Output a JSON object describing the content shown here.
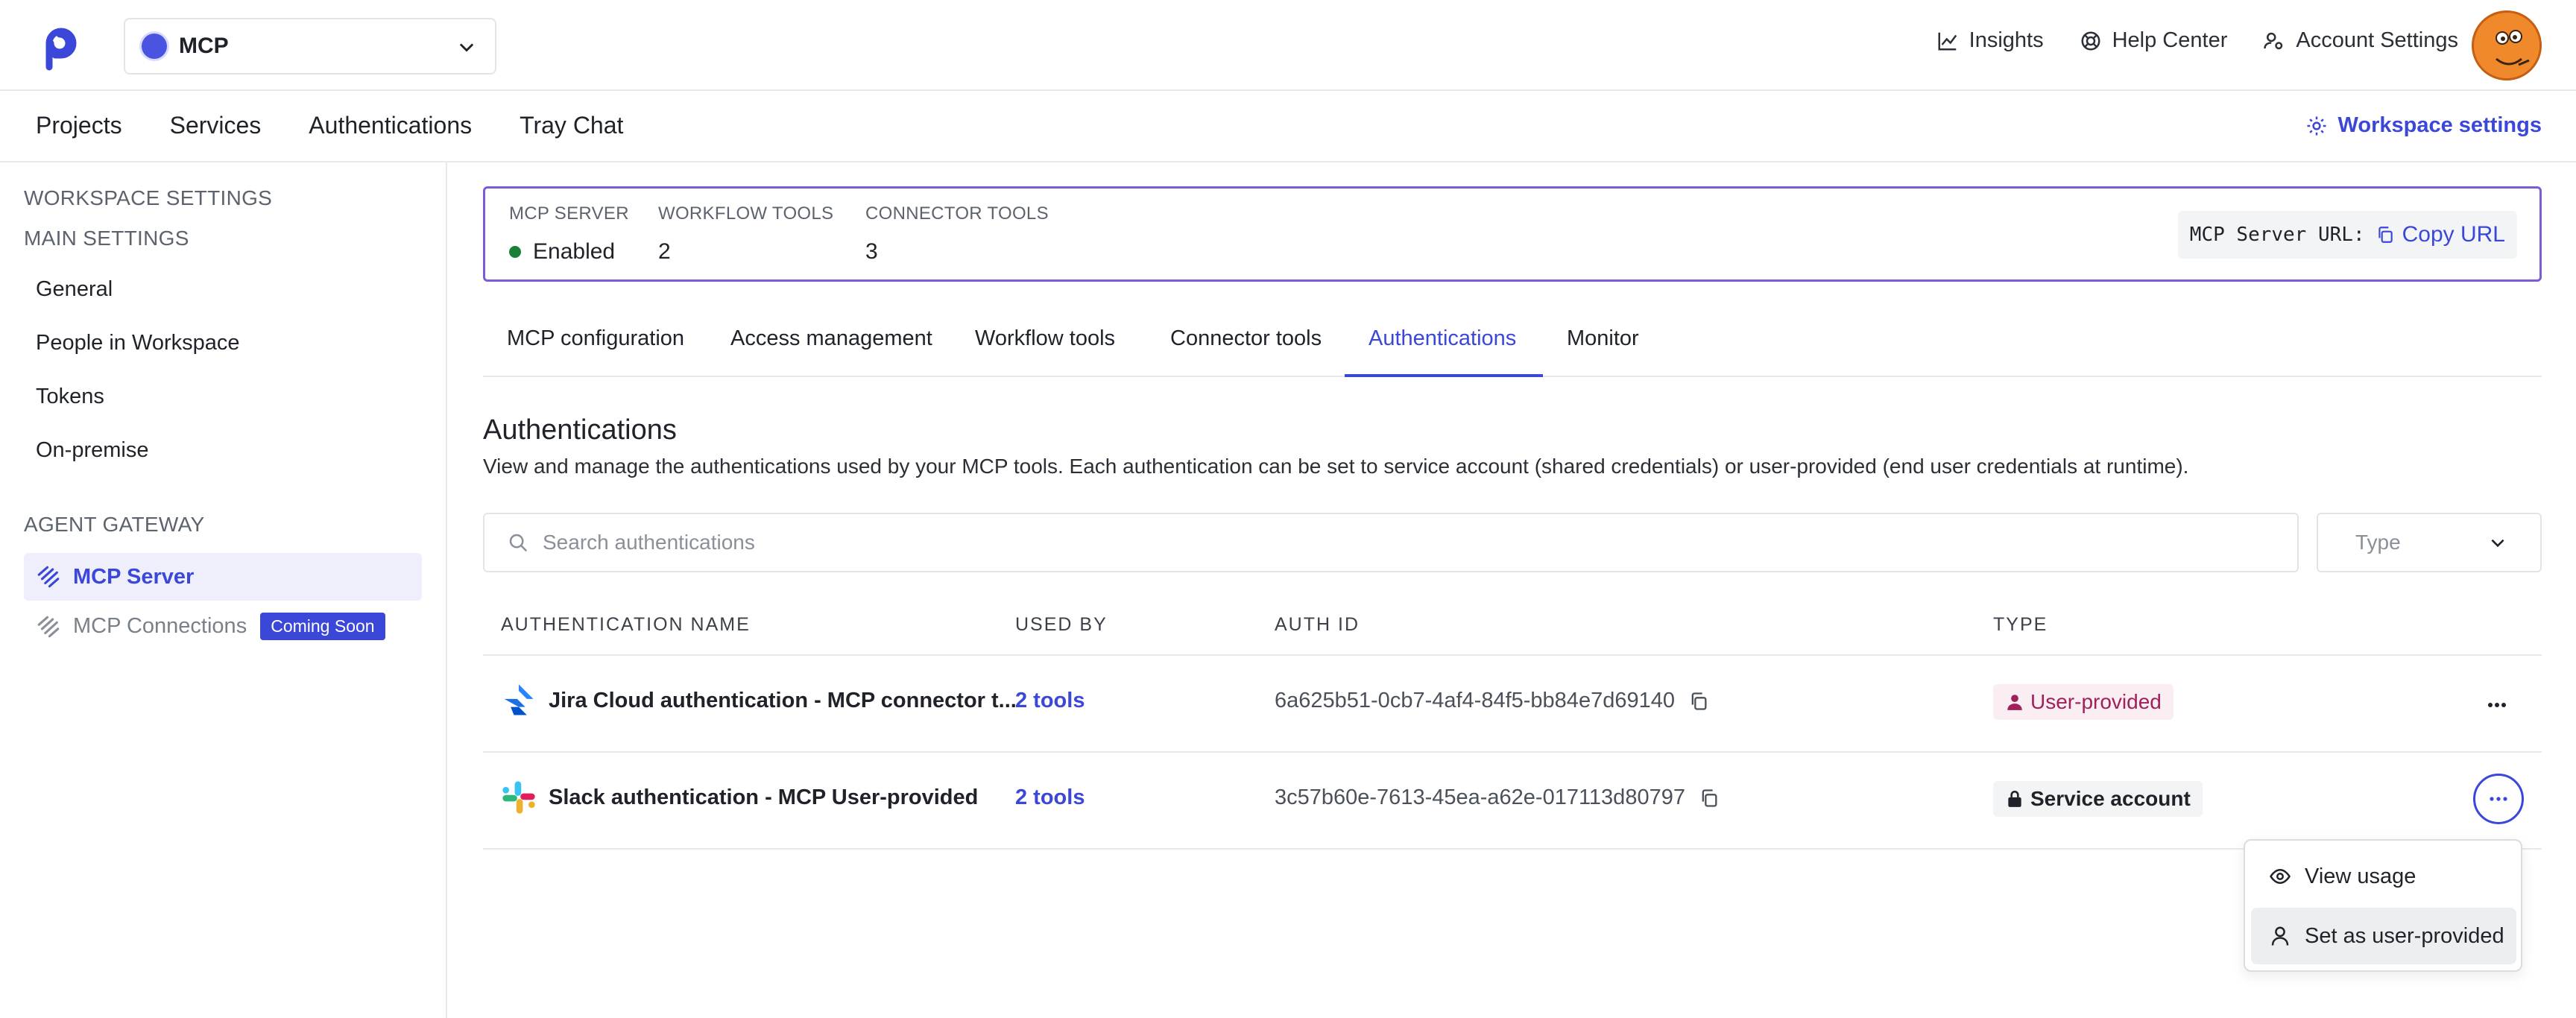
{
  "workspace": {
    "name": "MCP"
  },
  "top_links": [
    {
      "label": "Insights",
      "icon": "chart-line-icon"
    },
    {
      "label": "Help Center",
      "icon": "lifebuoy-icon"
    },
    {
      "label": "Account Settings",
      "icon": "account-settings-icon"
    }
  ],
  "nav": {
    "items": [
      "Projects",
      "Services",
      "Authentications",
      "Tray Chat"
    ],
    "workspace_settings": "Workspace settings"
  },
  "sidebar": {
    "heading": "WORKSPACE SETTINGS",
    "main_heading": "MAIN SETTINGS",
    "main_items": [
      "General",
      "People in Workspace",
      "Tokens",
      "On-premise"
    ],
    "gateway_heading": "AGENT GATEWAY",
    "mcp_server": "MCP Server",
    "mcp_connections": "MCP Connections",
    "coming_soon": "Coming Soon"
  },
  "mcp_summary": {
    "server_label": "MCP SERVER",
    "server_value": "Enabled",
    "workflow_label": "WORKFLOW TOOLS",
    "workflow_value": "2",
    "connector_label": "CONNECTOR TOOLS",
    "connector_value": "3",
    "url_label": "MCP Server URL:",
    "copy_url": "Copy URL"
  },
  "tabs": [
    "MCP configuration",
    "Access management",
    "Workflow tools",
    "Connector tools",
    "Authentications",
    "Monitor"
  ],
  "active_tab": "Authentications",
  "section": {
    "title": "Authentications",
    "description": "View and manage the authentications used by your MCP tools. Each authentication can be set to service account (shared credentials) or user-provided (end user credentials at runtime)."
  },
  "search": {
    "placeholder": "Search authentications"
  },
  "type_filter": {
    "placeholder": "Type"
  },
  "table": {
    "headers": [
      "AUTHENTICATION NAME",
      "USED BY",
      "AUTH ID",
      "TYPE"
    ],
    "rows": [
      {
        "icon": "jira-icon",
        "name": "Jira Cloud authentication - MCP connector t...",
        "used_by": "2 tools",
        "auth_id": "6a625b51-0cb7-4af4-84f5-bb84e7d69140",
        "type": "User-provided"
      },
      {
        "icon": "slack-icon",
        "name": "Slack authentication - MCP User-provided",
        "used_by": "2 tools",
        "auth_id": "3c57b60e-7613-45ea-a62e-017113d80797",
        "type": "Service account"
      }
    ]
  },
  "row_menu": {
    "items": [
      "View usage",
      "Set as user-provided"
    ]
  },
  "colors": {
    "accent": "#3b47d8",
    "server_box_border": "#7b5bd6",
    "enabled": "#1b7f3b",
    "user_provided": "#a0205a"
  }
}
